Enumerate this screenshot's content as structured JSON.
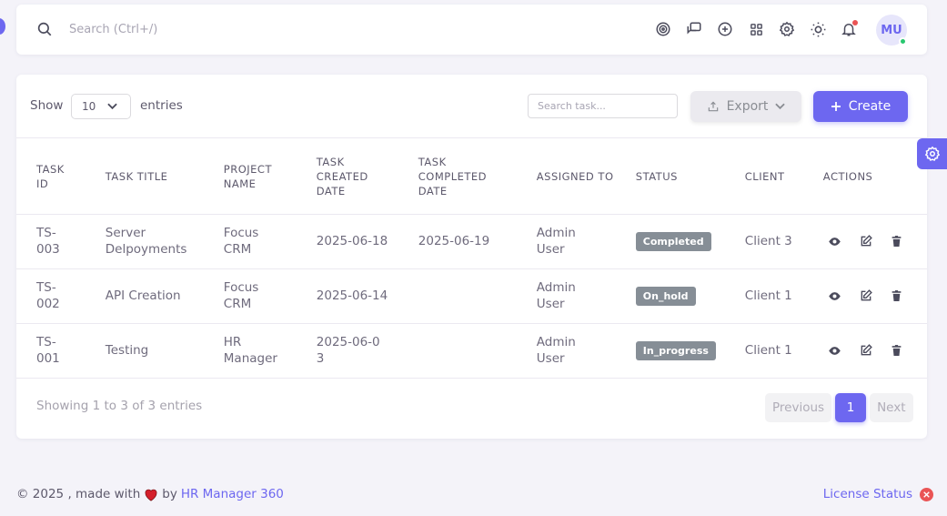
{
  "navbar": {
    "search_placeholder": "Search (Ctrl+/)",
    "icons": [
      "target-icon",
      "chat-icon",
      "add-circle-icon",
      "grid-icon",
      "settings-icon",
      "theme-sun-icon",
      "bell-icon"
    ],
    "avatar_initials": "MU",
    "accent": "#6d67f0"
  },
  "toolbar": {
    "show_label": "Show",
    "entries_value": "10",
    "entries_label": "entries",
    "search_placeholder": "Search task...",
    "export_label": "Export",
    "create_label": "Create"
  },
  "table": {
    "headers": {
      "task_id": "Task ID",
      "task_title": "Task Title",
      "project_name": "Project Name",
      "created_date": "Task Created Date",
      "completed_date": "Task Completed Date",
      "assigned_to": "Assigned To",
      "status": "Status",
      "client": "Client",
      "actions": "Actions"
    },
    "rows": [
      {
        "id": "TS-003",
        "title": "Server Delpoyments",
        "project": "Focus CRM",
        "created": "2025-06-18",
        "completed": "2025-06-19",
        "assigned": "Admin User",
        "status": "Completed",
        "client": "Client 3"
      },
      {
        "id": "TS-002",
        "title": "API Creation",
        "project": "Focus CRM",
        "created": "2025-06-14",
        "completed": "",
        "assigned": "Admin User",
        "status": "On_hold",
        "client": "Client 1"
      },
      {
        "id": "TS-001",
        "title": "Testing",
        "project": "HR Manager",
        "created": "2025-06-03",
        "completed": "",
        "assigned": "Admin User",
        "status": "In_progress",
        "client": "Client 1"
      }
    ]
  },
  "pagination": {
    "info": "Showing 1 to 3 of 3 entries",
    "previous": "Previous",
    "current": "1",
    "next": "Next"
  },
  "footer": {
    "copyright_prefix": "© 2025 , made with",
    "by": "by",
    "brand": "HR Manager 360",
    "license": "License Status"
  }
}
